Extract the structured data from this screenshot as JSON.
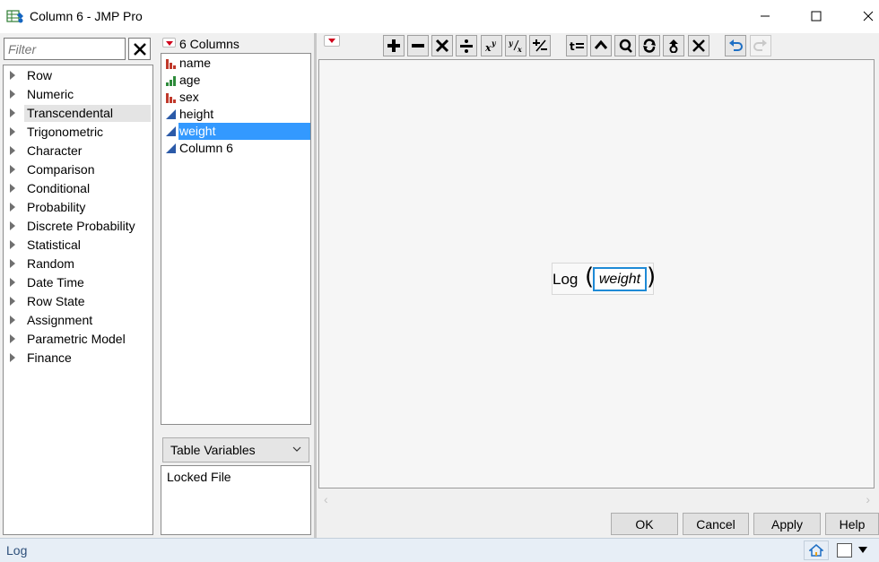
{
  "window": {
    "title": "Column 6 - JMP Pro"
  },
  "functions": {
    "filter_placeholder": "Filter",
    "items": [
      {
        "label": "Row"
      },
      {
        "label": "Numeric"
      },
      {
        "label": "Transcendental"
      },
      {
        "label": "Trigonometric"
      },
      {
        "label": "Character"
      },
      {
        "label": "Comparison"
      },
      {
        "label": "Conditional"
      },
      {
        "label": "Probability"
      },
      {
        "label": "Discrete Probability"
      },
      {
        "label": "Statistical"
      },
      {
        "label": "Random"
      },
      {
        "label": "Date Time"
      },
      {
        "label": "Row State"
      },
      {
        "label": "Assignment"
      },
      {
        "label": "Parametric Model"
      },
      {
        "label": "Finance"
      }
    ],
    "selected_index": 2
  },
  "columns": {
    "count_label": "6 Columns",
    "items": [
      {
        "label": "name",
        "icon": "nominal-bar-icon",
        "color": "#c0392b"
      },
      {
        "label": "age",
        "icon": "ordinal-bar-icon",
        "color": "#2e8b3a"
      },
      {
        "label": "sex",
        "icon": "nominal-bar-icon",
        "color": "#c0392b"
      },
      {
        "label": "height",
        "icon": "continuous-triangle-icon",
        "color": "#2b5aa8"
      },
      {
        "label": "weight",
        "icon": "continuous-triangle-icon",
        "color": "#2b5aa8"
      },
      {
        "label": "Column 6",
        "icon": "continuous-triangle-icon",
        "color": "#2b5aa8"
      }
    ],
    "selected_index": 4,
    "table_variables_label": "Table Variables",
    "locked_file_label": "Locked File"
  },
  "editor": {
    "formula_function": "Log",
    "formula_argument": "weight",
    "toolbar": [
      {
        "name": "add-icon"
      },
      {
        "name": "subtract-icon"
      },
      {
        "name": "multiply-icon"
      },
      {
        "name": "divide-icon"
      },
      {
        "name": "power-icon"
      },
      {
        "name": "root-icon"
      },
      {
        "name": "negate-icon"
      },
      {
        "name": "assign-icon"
      },
      {
        "name": "peel-icon"
      },
      {
        "name": "local-icon"
      },
      {
        "name": "swap-icon"
      },
      {
        "name": "group-icon"
      },
      {
        "name": "delete-icon"
      },
      {
        "name": "undo-icon"
      },
      {
        "name": "redo-icon"
      }
    ]
  },
  "buttons": {
    "ok": "OK",
    "cancel": "Cancel",
    "apply": "Apply",
    "help": "Help"
  },
  "status": {
    "text": "Log"
  },
  "colors": {
    "selection": "#3399ff",
    "focus_border": "#1e8ad6",
    "menu_triangle": "#d0021b"
  }
}
